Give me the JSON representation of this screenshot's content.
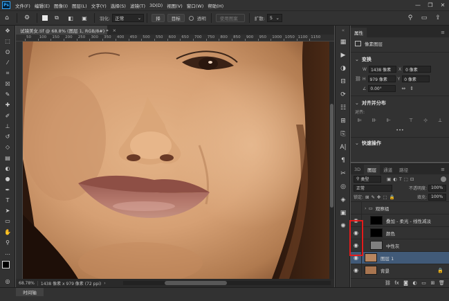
{
  "menubar": {
    "logo": "Ps",
    "items": [
      "文件(F)",
      "编辑(E)",
      "图像(I)",
      "图层(L)",
      "文字(Y)",
      "选择(S)",
      "滤镜(T)",
      "3D(D)",
      "视图(V)",
      "窗口(W)",
      "帮助(H)"
    ],
    "minimize": "—",
    "restore": "❐",
    "close": "✕"
  },
  "optionsbar": {
    "feather_label": "羽化:",
    "mode_value": "正常",
    "btn_subtract": "择",
    "btn_target": "目标",
    "transparent_label": "透明",
    "btn_use_pattern": "使用图案",
    "spread_label": "扩散:",
    "spread_value": "5",
    "icons": [
      "search-icon",
      "window-icon",
      "share-icon"
    ]
  },
  "document": {
    "tab_title": "试镜美女.tif @ 68.8% (图层 1, RGB/8#) *",
    "tab_close": "×",
    "zoom": "68.78%",
    "size_info": "1438 像素 x 979 像素 (72 ppi)",
    "ruler_labels": [
      "50",
      "100",
      "150",
      "200",
      "250",
      "300",
      "350",
      "400",
      "450",
      "500",
      "550",
      "600",
      "650",
      "700",
      "750",
      "800",
      "850",
      "900",
      "950",
      "1000",
      "1050",
      "1100",
      "1150"
    ]
  },
  "timeline": {
    "tab": "时间轴"
  },
  "properties": {
    "tab": "属性",
    "layer_kind": "像素图层",
    "transform_title": "变换",
    "w_label": "W",
    "w_value": "1438 像素",
    "x_label": "X",
    "x_value": "0 像素",
    "h_label": "H",
    "h_value": "979 像素",
    "y_label": "Y",
    "y_value": "0 像素",
    "angle_value": "0.00°",
    "align_title": "对齐并分布",
    "align_sub": "对齐:",
    "more": "•••",
    "quick_actions": "快速操作"
  },
  "layers": {
    "tabs": [
      "3D",
      "图层",
      "通道",
      "路径"
    ],
    "active_tab": "图层",
    "filter_kind": "类型",
    "blend_mode": "正常",
    "opacity_label": "不透明度:",
    "opacity_value": "100%",
    "lock_label": "锁定:",
    "fill_label": "填充:",
    "fill_value": "100%",
    "items": [
      {
        "name": "观察组",
        "type": "group"
      },
      {
        "name": "叠加 - 柔光 - 线性减淡",
        "type": "fill-black"
      },
      {
        "name": "颜色",
        "type": "fill-black"
      },
      {
        "name": "中性灰",
        "type": "fill-gray"
      },
      {
        "name": "图层 1",
        "type": "photo",
        "selected": true
      },
      {
        "name": "背景",
        "type": "photo",
        "locked": true
      }
    ]
  },
  "colors": {
    "accent": "#31a8ff",
    "selection": "#415a78",
    "highlight": "#e41b1b"
  }
}
